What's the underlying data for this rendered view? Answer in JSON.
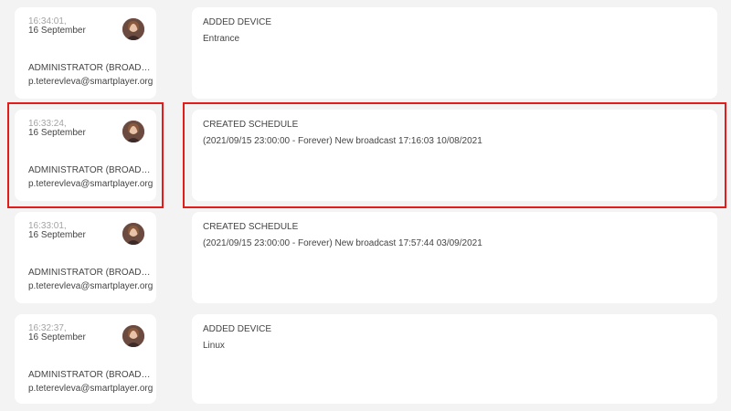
{
  "entries": [
    {
      "time": "16:34:01,",
      "date": "16 September",
      "role": "ADMINISTRATOR (BROADCASTER)",
      "email": "p.teterevleva@smartplayer.org",
      "action": "ADDED DEVICE",
      "description": "Entrance",
      "avatar": "user-avatar-photo"
    },
    {
      "time": "16:33:24,",
      "date": "16 September",
      "role": "ADMINISTRATOR (BROADCASTER)",
      "email": "p.teterevleva@smartplayer.org",
      "action": "CREATED SCHEDULE",
      "description": "(2021/09/15 23:00:00 - Forever) New broadcast 17:16:03 10/08/2021",
      "avatar": "user-avatar-photo",
      "highlighted": true
    },
    {
      "time": "16:33:01,",
      "date": "16 September",
      "role": "ADMINISTRATOR (BROADCASTER)",
      "email": "p.teterevleva@smartplayer.org",
      "action": "CREATED SCHEDULE",
      "description": "(2021/09/15 23:00:00 - Forever) New broadcast 17:57:44 03/09/2021",
      "avatar": "user-avatar-photo"
    },
    {
      "time": "16:32:37,",
      "date": "16 September",
      "role": "ADMINISTRATOR (BROADCASTER)",
      "email": "p.teterevleva@smartplayer.org",
      "action": "ADDED DEVICE",
      "description": "Linux",
      "avatar": "user-avatar-photo"
    }
  ],
  "colors": {
    "background": "#f3f3f3",
    "card": "#ffffff",
    "highlight": "#e21b1b",
    "text": "#444444",
    "muted": "#a3a3a3"
  }
}
